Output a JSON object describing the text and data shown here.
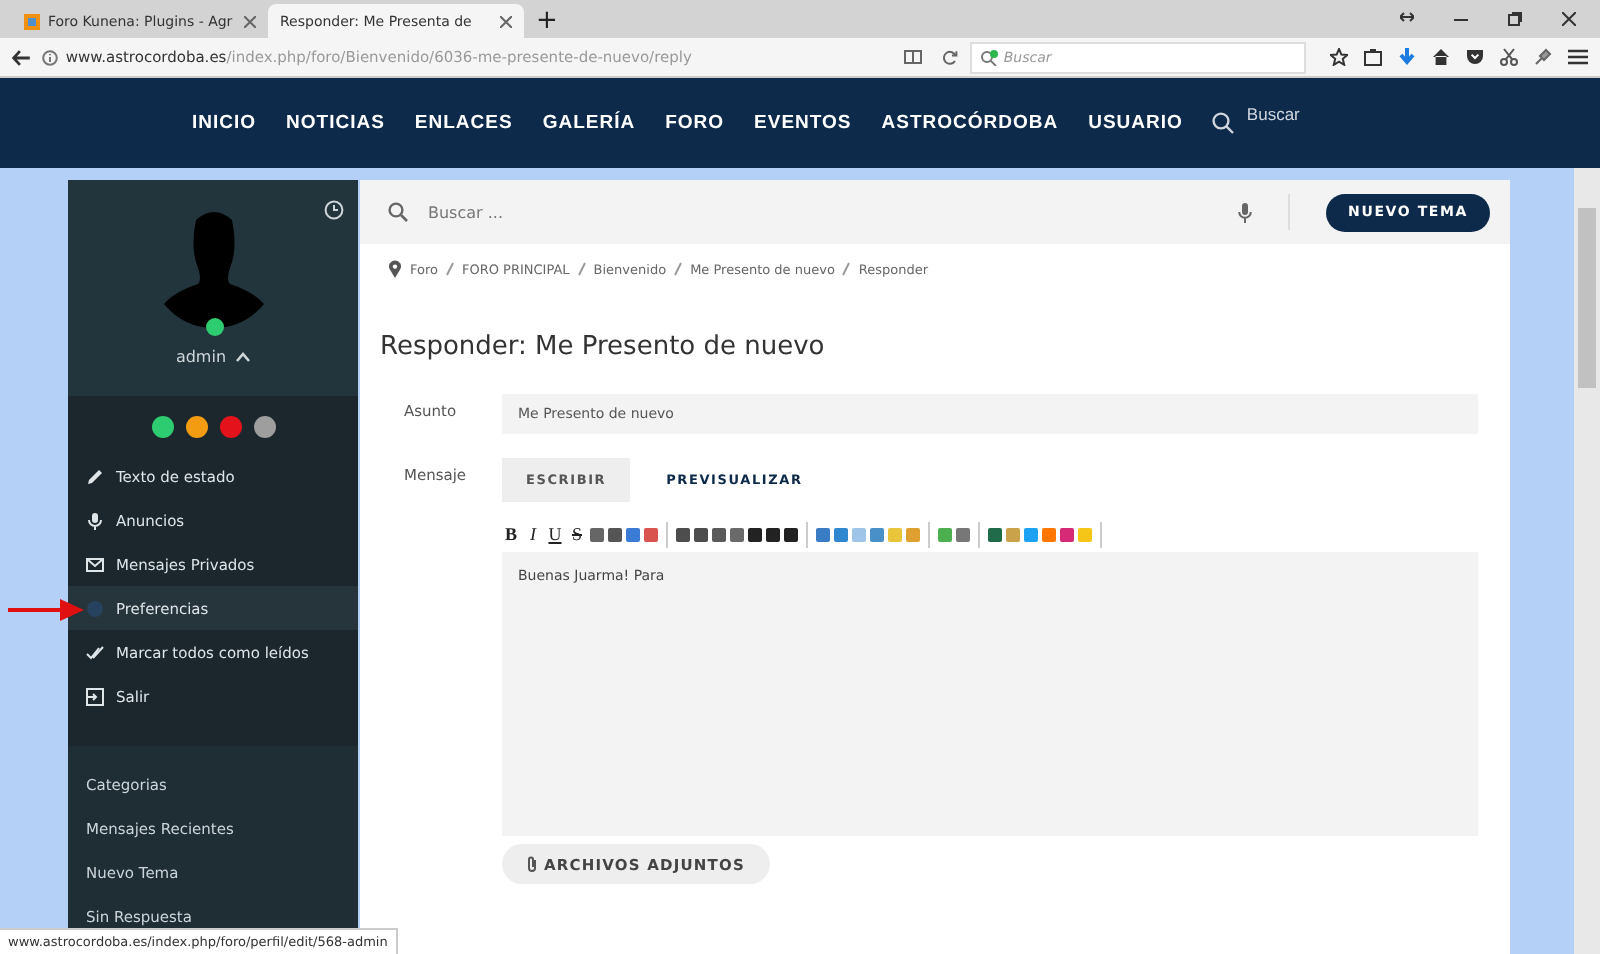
{
  "browser": {
    "tabs": [
      {
        "title": "Foro Kunena: Plugins - Agr",
        "selected": false
      },
      {
        "title": "Responder: Me Presenta de",
        "selected": true
      }
    ],
    "new_tab": "+",
    "url_host": "www.astrocordoba.es",
    "url_path": "/index.php/foro/Bienvenido/6036-me-presente-de-nuevo/reply",
    "search_placeholder": "Buscar"
  },
  "nav": {
    "items": [
      "INICIO",
      "NOTICIAS",
      "ENLACES",
      "GALERÍA",
      "FORO",
      "EVENTOS",
      "ASTROCÓRDOBA",
      "USUARIO"
    ],
    "search_placeholder": "Buscar"
  },
  "sidebar": {
    "username": "admin",
    "online": true,
    "status_buttons": [
      {
        "color": "#2ecc71"
      },
      {
        "color": "#f39c12"
      },
      {
        "color": "#e3121b"
      },
      {
        "color": "#9e9e9e"
      }
    ],
    "menu": [
      {
        "label": "Texto de estado",
        "kind": "pencil",
        "selected": false
      },
      {
        "label": "Anuncios",
        "kind": "mic",
        "selected": false
      },
      {
        "label": "Mensajes Privados",
        "kind": "envelope",
        "selected": false
      },
      {
        "label": "Preferencias",
        "kind": "dot",
        "selected": true
      },
      {
        "label": "Marcar todos como leídos",
        "kind": "checks",
        "selected": false
      },
      {
        "label": "Salir",
        "kind": "exit",
        "selected": false
      }
    ],
    "links": [
      "Categorias",
      "Mensajes Recientes",
      "Nuevo Tema",
      "Sin Respuesta"
    ]
  },
  "main": {
    "search_placeholder": "Buscar ...",
    "new_topic": "NUEVO TEMA",
    "breadcrumbs": [
      "Foro",
      "FORO PRINCIPAL",
      "Bienvenido",
      "Me Presento de nuevo",
      "Responder"
    ],
    "title": "Responder: Me Presento de nuevo",
    "subject_label": "Asunto",
    "subject": "Me Presento de nuevo",
    "message_label": "Mensaje",
    "editor_tabs": [
      {
        "label": "ESCRIBIR",
        "selected": true
      },
      {
        "label": "PREVISUALIZAR",
        "selected": false
      }
    ],
    "toolbar": [
      {
        "kind": "bold",
        "label": "B"
      },
      {
        "kind": "italic",
        "label": "I"
      },
      {
        "kind": "underline",
        "label": "U"
      },
      {
        "kind": "strike",
        "label": "S"
      },
      {
        "kind": "icon",
        "color": "#666666"
      },
      {
        "kind": "icon",
        "color": "#555555"
      },
      {
        "kind": "icon",
        "color": "#3a7bd5"
      },
      {
        "kind": "icon",
        "color": "#d9534f"
      },
      {
        "kind": "separator"
      },
      {
        "kind": "icon",
        "color": "#4d4d4d"
      },
      {
        "kind": "icon",
        "color": "#4d4d4d"
      },
      {
        "kind": "icon",
        "color": "#5a5a5a"
      },
      {
        "kind": "icon",
        "color": "#6a6a6a"
      },
      {
        "kind": "icon",
        "color": "#222222"
      },
      {
        "kind": "icon",
        "color": "#222222"
      },
      {
        "kind": "icon",
        "color": "#222222"
      },
      {
        "kind": "separator"
      },
      {
        "kind": "icon",
        "color": "#3b7dc4"
      },
      {
        "kind": "icon",
        "color": "#2f87d0"
      },
      {
        "kind": "icon",
        "color": "#9ec4e8"
      },
      {
        "kind": "icon",
        "color": "#4a90c8"
      },
      {
        "kind": "icon",
        "color": "#e8c53a"
      },
      {
        "kind": "icon",
        "color": "#e0a030"
      },
      {
        "kind": "separator"
      },
      {
        "kind": "icon",
        "color": "#4caf50"
      },
      {
        "kind": "icon",
        "color": "#777777"
      },
      {
        "kind": "separator"
      },
      {
        "kind": "icon",
        "color": "#1f6b4a"
      },
      {
        "kind": "icon",
        "color": "#c9a24a"
      },
      {
        "kind": "icon",
        "color": "#1da1f2"
      },
      {
        "kind": "icon",
        "color": "#ff7700"
      },
      {
        "kind": "icon",
        "color": "#d62976"
      },
      {
        "kind": "icon",
        "color": "#f5c518"
      },
      {
        "kind": "separator"
      }
    ],
    "message": "Buenas Juarma! Para",
    "attachments": "ARCHIVOS ADJUNTOS"
  },
  "status_link": "www.astrocordoba.es/index.php/foro/perfil/edit/568-admin"
}
